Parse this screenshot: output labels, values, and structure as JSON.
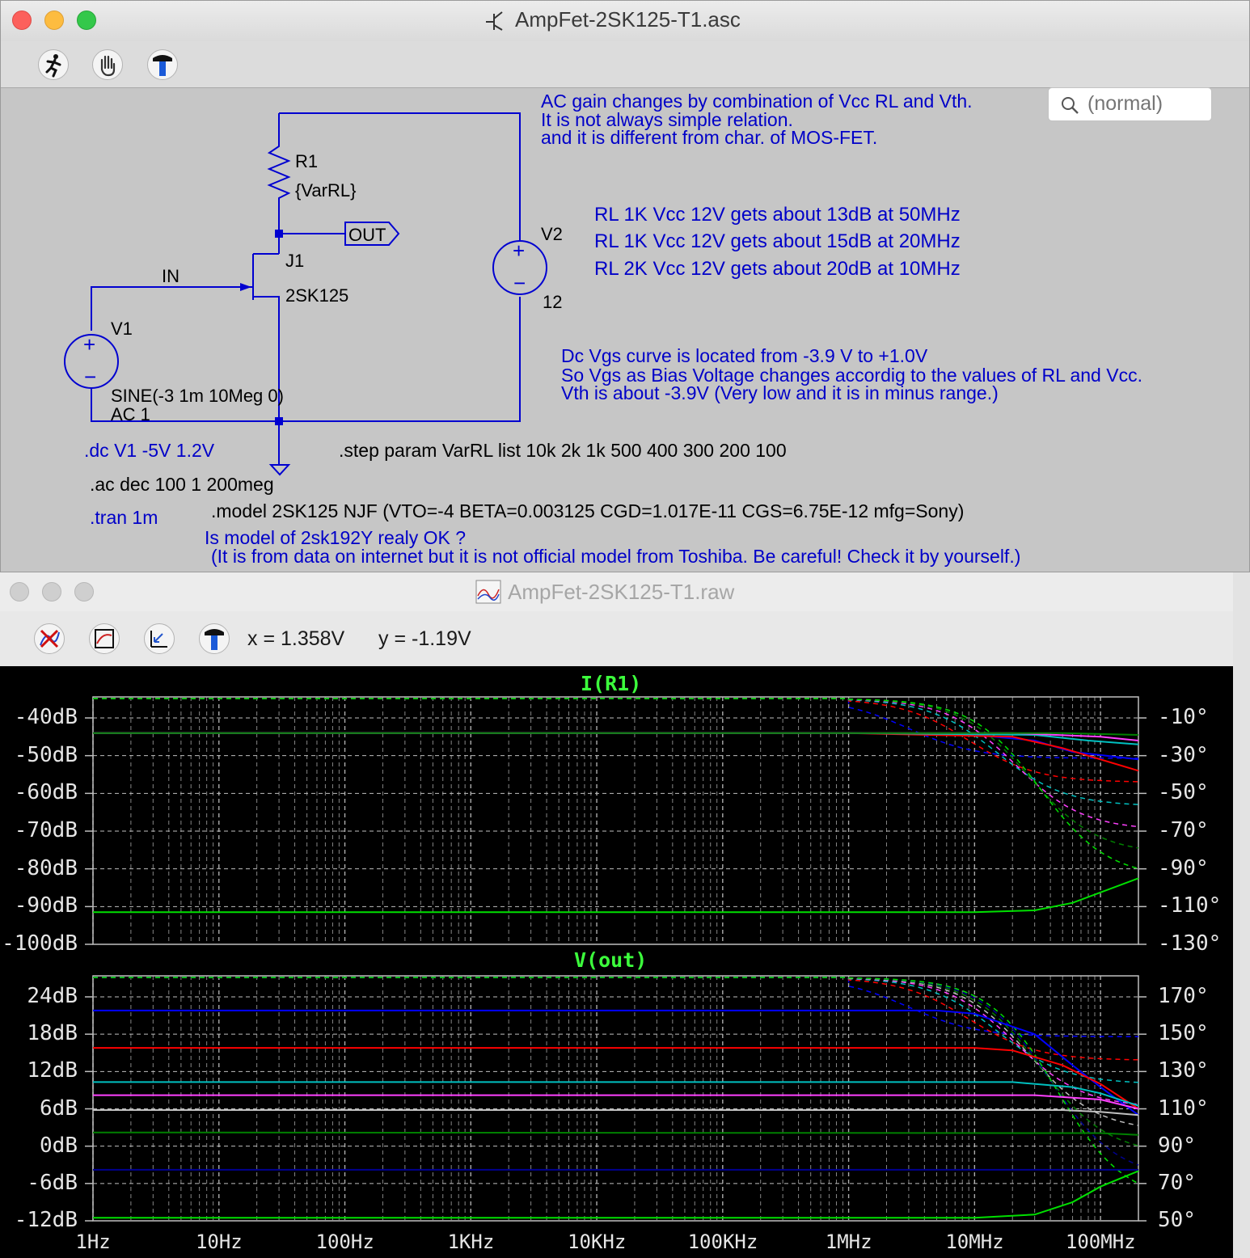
{
  "schematic_window": {
    "title": "AmpFet-2SK125-T1.asc",
    "search_placeholder": "(normal)",
    "toolbar_icons": [
      "run-icon",
      "hand-icon",
      "hammer-icon"
    ],
    "components": {
      "r1_name": "R1",
      "r1_value": "{VarRL}",
      "out_label": "OUT",
      "in_label": "IN",
      "j1_name": "J1",
      "j1_value": "2SK125",
      "v1_name": "V1",
      "v1_value1": "SINE(-3 1m 10Meg 0)",
      "v1_value2": "AC 1",
      "v2_name": "V2",
      "v2_value": "12",
      "plus": "+",
      "minus": "−"
    },
    "directives": {
      "dc": ".dc V1 -5V 1.2V",
      "ac": ".ac dec 100 1 200meg",
      "tran": ".tran 1m",
      "step": ".step param VarRL list 10k 2k 1k 500 400 300 200 100",
      "model": ".model 2SK125 NJF (VTO=-4 BETA=0.003125 CGD=1.017E-11 CGS=6.75E-12 mfg=Sony)"
    },
    "notes": {
      "gain_1": "AC gain changes by combination of Vcc RL and Vth.",
      "gain_2": "It is not always simple relation.",
      "gain_3": "and it is different from char. of MOS-FET.",
      "rl_1": "RL  1K Vcc 12V gets about 13dB at 50MHz",
      "rl_2": "RL  1K Vcc 12V gets about 15dB at 20MHz",
      "rl_3": "RL  2K Vcc 12V gets about 20dB at 10MHz",
      "vgs_1": "Dc Vgs curve is located  from  -3.9 V to +1.0V",
      "vgs_2": "So Vgs as Bias Voltage changes accordig to the values of RL and Vcc.",
      "vgs_3": "Vth is about -3.9V (Very low and it is in minus range.)",
      "model_q_1": "Is model of 2sk192Y realy OK ?",
      "model_q_2": "(It is from data on internet but it is not official model from Toshiba. Be careful! Check it by yourself.)"
    }
  },
  "waveform_window": {
    "title": "AmpFet-2SK125-T1.raw",
    "toolbar_icons": [
      "clear-traces-icon",
      "autorange-icon",
      "zoom-back-icon",
      "hammer-icon"
    ],
    "x_readout": "x = 1.358V",
    "y_readout": "y = -1.19V",
    "colors": {
      "background": "#000000",
      "grid": "#bfbfbf",
      "title": "#3cff3c",
      "traces": [
        "#00e000",
        "#0000ff",
        "#ff0000",
        "#00c0c0",
        "#ff40ff",
        "#c0c0c0",
        "#008000",
        "#000090"
      ]
    }
  },
  "chart_data": [
    {
      "type": "line",
      "title": "I(R1)",
      "x_scale": "log",
      "x_range_hz": [
        1,
        200000000
      ],
      "x_tick_labels": [
        "1Hz",
        "10Hz",
        "100Hz",
        "1KHz",
        "10KHz",
        "100KHz",
        "1MHz",
        "10MHz",
        "100MHz"
      ],
      "ylim_db": [
        -100,
        -35
      ],
      "y_tick_labels": [
        "-40dB",
        "-50dB",
        "-60dB",
        "-70dB",
        "-80dB",
        "-90dB",
        "-100dB"
      ],
      "y2_tick_labels": [
        "-10°",
        "-30°",
        "-50°",
        "-70°",
        "-90°",
        "-110°",
        "-130°"
      ],
      "series": [
        {
          "color": "#0000ff",
          "values_db": [
            [
              1,
              -44
            ],
            [
              1000000.0,
              -44
            ],
            [
              10000000.0,
              -44.5
            ],
            [
              30000000.0,
              -46
            ],
            [
              60000000.0,
              -49
            ],
            [
              200000000.0,
              -51
            ]
          ]
        },
        {
          "color": "#ff0000",
          "values_db": [
            [
              1,
              -44
            ],
            [
              1000000.0,
              -44
            ],
            [
              20000000.0,
              -45
            ],
            [
              50000000.0,
              -48
            ],
            [
              200000000.0,
              -54
            ]
          ]
        },
        {
          "color": "#00c0c0",
          "values_db": [
            [
              1,
              -44
            ],
            [
              1000000.0,
              -44
            ],
            [
              30000000.0,
              -44.5
            ],
            [
              80000000.0,
              -46
            ],
            [
              200000000.0,
              -47
            ]
          ]
        },
        {
          "color": "#ff40ff",
          "values_db": [
            [
              1,
              -44
            ],
            [
              20000000.0,
              -44
            ],
            [
              100000000.0,
              -45
            ],
            [
              200000000.0,
              -46
            ]
          ]
        },
        {
          "color": "#008000",
          "values_db": [
            [
              1,
              -44
            ],
            [
              50000000.0,
              -44
            ],
            [
              200000000.0,
              -44.5
            ]
          ]
        },
        {
          "color": "#00e000",
          "values_db": [
            [
              1,
              -91.5
            ],
            [
              10000000.0,
              -91.5
            ],
            [
              30000000.0,
              -91
            ],
            [
              60000000.0,
              -89
            ],
            [
              200000000.0,
              -82.5
            ]
          ]
        }
      ]
    },
    {
      "type": "line",
      "title": "V(out)",
      "x_scale": "log",
      "x_range_hz": [
        1,
        200000000
      ],
      "x_tick_labels": [
        "1Hz",
        "10Hz",
        "100Hz",
        "1KHz",
        "10KHz",
        "100KHz",
        "1MHz",
        "10MHz",
        "100MHz"
      ],
      "ylim_db": [
        -12,
        27
      ],
      "y_tick_labels": [
        "24dB",
        "18dB",
        "12dB",
        "6dB",
        "0dB",
        "-6dB",
        "-12dB"
      ],
      "y2_tick_labels": [
        "170°",
        "150°",
        "130°",
        "110°",
        "90°",
        "70°",
        "50°"
      ],
      "series": [
        {
          "color": "#0000ff",
          "values_db": [
            [
              1,
              21.8
            ],
            [
              5000000.0,
              21.8
            ],
            [
              10000000.0,
              21.3
            ],
            [
              30000000.0,
              18
            ],
            [
              60000000.0,
              13
            ],
            [
              100000000.0,
              9.5
            ],
            [
              200000000.0,
              5
            ]
          ]
        },
        {
          "color": "#ff0000",
          "values_db": [
            [
              1,
              15.8
            ],
            [
              10000000.0,
              15.8
            ],
            [
              20000000.0,
              15.4
            ],
            [
              50000000.0,
              13
            ],
            [
              100000000.0,
              10
            ],
            [
              200000000.0,
              6
            ]
          ]
        },
        {
          "color": "#00c0c0",
          "values_db": [
            [
              1,
              10.3
            ],
            [
              20000000.0,
              10.3
            ],
            [
              60000000.0,
              9.5
            ],
            [
              100000000.0,
              8.5
            ],
            [
              200000000.0,
              6.5
            ]
          ]
        },
        {
          "color": "#ff40ff",
          "values_db": [
            [
              1,
              8.2
            ],
            [
              30000000.0,
              8.2
            ],
            [
              100000000.0,
              7.5
            ],
            [
              200000000.0,
              6
            ]
          ]
        },
        {
          "color": "#c0c0c0",
          "values_db": [
            [
              1,
              5.8
            ],
            [
              50000000.0,
              5.8
            ],
            [
              100000000.0,
              5.5
            ],
            [
              200000000.0,
              5
            ]
          ]
        },
        {
          "color": "#008000",
          "values_db": [
            [
              1,
              2.2
            ],
            [
              100000000.0,
              2.1
            ],
            [
              200000000.0,
              1.8
            ]
          ]
        },
        {
          "color": "#000090",
          "values_db": [
            [
              1,
              -3.8
            ],
            [
              200000000.0,
              -3.8
            ]
          ]
        },
        {
          "color": "#00e000",
          "values_db": [
            [
              1,
              -11.5
            ],
            [
              10000000.0,
              -11.5
            ],
            [
              30000000.0,
              -11
            ],
            [
              60000000.0,
              -9
            ],
            [
              100000000.0,
              -6.5
            ],
            [
              200000000.0,
              -4
            ]
          ]
        }
      ]
    }
  ]
}
